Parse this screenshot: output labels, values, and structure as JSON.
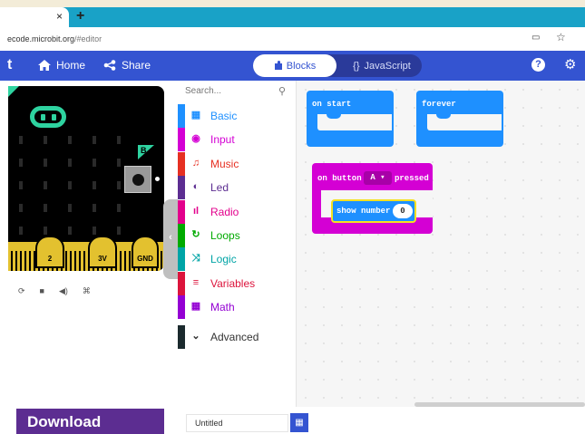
{
  "browser": {
    "tab_close": "×",
    "new_tab": "+",
    "url_host": "ecode.microbit.org",
    "url_path": "/#editor",
    "reader_icon": "▭",
    "star_icon": "☆"
  },
  "header": {
    "logo_fragment": "t",
    "home_label": "Home",
    "share_label": "Share",
    "blocks_label": "Blocks",
    "javascript_label": "JavaScript",
    "help_icon": "?",
    "settings_icon": "⚙",
    "accent": "#3454d1"
  },
  "simulator": {
    "button_b_label": "B",
    "pins": [
      "2",
      "3V",
      "GND"
    ],
    "controls": [
      "⟳",
      "■",
      "◀)",
      "⌘"
    ]
  },
  "toolbox": {
    "search_placeholder": "Search...",
    "categories": [
      {
        "label": "Basic",
        "icon": "▦",
        "color": "#1e90ff"
      },
      {
        "label": "Input",
        "icon": "◉",
        "color": "#d400d4"
      },
      {
        "label": "Music",
        "icon": "♫",
        "color": "#e63022"
      },
      {
        "label": "Led",
        "icon": "◐",
        "color": "#5c2d91"
      },
      {
        "label": "Radio",
        "icon": "ıl",
        "color": "#e3008c"
      },
      {
        "label": "Loops",
        "icon": "↻",
        "color": "#00aa00"
      },
      {
        "label": "Logic",
        "icon": "⤨",
        "color": "#00a4a6"
      },
      {
        "label": "Variables",
        "icon": "≡",
        "color": "#dc143c"
      },
      {
        "label": "Math",
        "icon": "▦",
        "color": "#9400d3"
      }
    ],
    "advanced": {
      "label": "Advanced",
      "icon": "⌄",
      "color": "#3c3c3c"
    }
  },
  "workspace": {
    "on_start": "on start",
    "forever": "forever",
    "on_button_prefix": "on button",
    "button_value": "A ▾",
    "on_button_suffix": "pressed",
    "show_number": "show number",
    "number_value": "0"
  },
  "footer": {
    "download_label": "Download",
    "project_name": "Untitled",
    "save_icon": "💾"
  }
}
